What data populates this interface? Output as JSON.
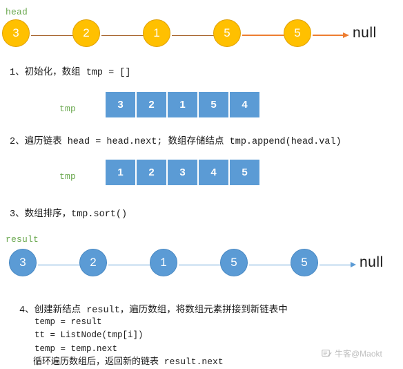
{
  "colors": {
    "node_orange_fill": "#FFC000",
    "node_orange_border": "#E0A000",
    "node_blue_fill": "#5B9BD5",
    "node_blue_border": "#4A8AC4",
    "arrow_brown": "#A6622B",
    "arrow_orange": "#ED7D31",
    "arrow_blue": "#5B9BD5",
    "label_green": "#6AA84F",
    "text_black": "#1A1A1A",
    "array_cell": "#5B9BD5",
    "watermark_gray": "#8A8A8A"
  },
  "top_list": {
    "pointer_label": "head",
    "nodes": [
      "3",
      "2",
      "1",
      "5",
      "5"
    ],
    "terminator": "null"
  },
  "steps": [
    {
      "id": "step-1",
      "heading": "1、初始化，数组 tmp = []",
      "array_label": "tmp",
      "array_values": [
        "3",
        "2",
        "1",
        "5",
        "4"
      ]
    },
    {
      "id": "step-2",
      "heading": "2、遍历链表 head = head.next; 数组存储结点 tmp.append(head.val)",
      "array_label": "tmp",
      "array_values": [
        "1",
        "2",
        "3",
        "4",
        "5"
      ]
    },
    {
      "id": "step-3",
      "heading": "3、数组排序，tmp.sort()"
    },
    {
      "id": "step-4",
      "heading": "4、创建新结点 result，遍历数组，将数组元素拼接到新链表中",
      "code_lines": [
        "temp = result",
        "tt = ListNode(tmp[i])",
        "temp = temp.next"
      ],
      "closing_line": "循环遍历数组后，返回新的链表 result.next"
    }
  ],
  "result_list": {
    "pointer_label": "result",
    "nodes": [
      "3",
      "2",
      "1",
      "5",
      "5"
    ],
    "terminator": "null"
  },
  "watermark": {
    "icon": "notebook-pen-icon",
    "text": "牛客@Maokt"
  }
}
